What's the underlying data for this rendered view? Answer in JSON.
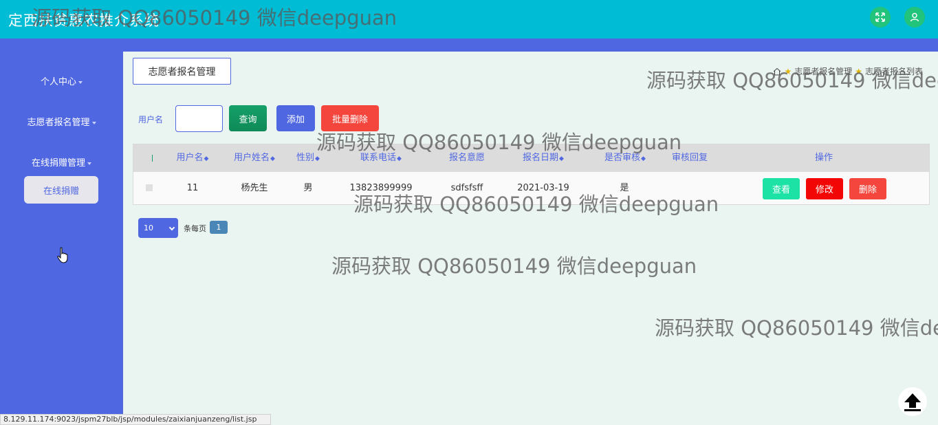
{
  "app": {
    "title": "定西扶贫惠农推介系统"
  },
  "header": {
    "fullscreen_icon": "expand-arrows-icon",
    "user_icon": "user-icon"
  },
  "sidebar": {
    "items": [
      {
        "label": "个人中心"
      },
      {
        "label": "志愿者报名管理"
      },
      {
        "label": "在线捐赠管理"
      }
    ],
    "active_sub": "在线捐赠"
  },
  "main": {
    "section_button": "志愿者报名管理",
    "breadcrumb": [
      "志愿者报名管理",
      "志愿者报名列表"
    ]
  },
  "search": {
    "label": "用户名",
    "value": "",
    "query": "查询",
    "add": "添加",
    "batch_delete": "批量删除"
  },
  "table": {
    "headers": [
      "用户名",
      "用户姓名",
      "性别",
      "联系电话",
      "报名意愿",
      "报名日期",
      "是否审核",
      "审核回复",
      "操作"
    ],
    "rows": [
      {
        "username": "11",
        "name": "杨先生",
        "gender": "男",
        "phone": "13823899999",
        "intention": "sdfsfsff",
        "date": "2021-03-19",
        "reviewed": "是",
        "reply": ""
      }
    ],
    "actions": {
      "view": "查看",
      "edit": "修改",
      "delete": "删除"
    }
  },
  "pager": {
    "page_size": "10",
    "per_page_label": "条每页",
    "current_page": "1"
  },
  "status_url": "8.129.11.174:9023/jspm27blb/jsp/modules/zaixianjuanzeng/list.jsp",
  "watermark": "源码获取 QQ86050149 微信deepguan",
  "colors": {
    "header": "#00bcd4",
    "sidebar": "#5067e2",
    "content_bg": "#eaf4f0",
    "accent": "#5067e2",
    "danger": "#f5463e",
    "success": "#16a069"
  }
}
